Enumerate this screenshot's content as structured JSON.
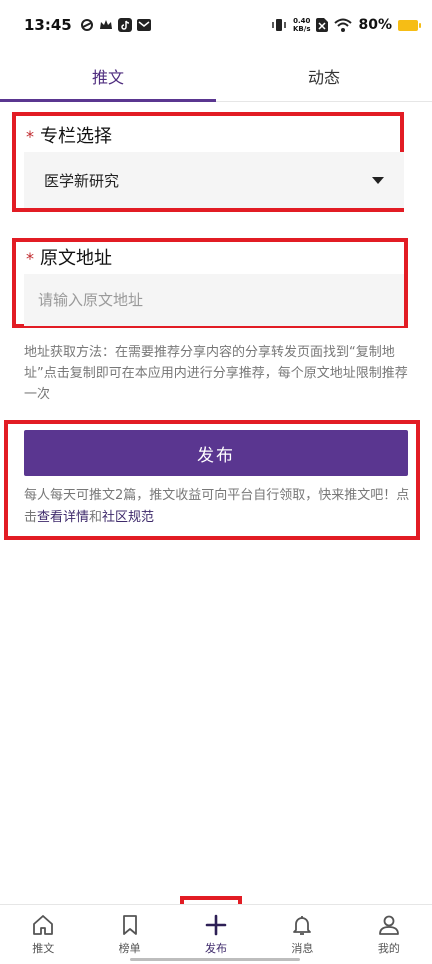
{
  "status_bar": {
    "time": "13:45",
    "net_speed_value": "0.40",
    "net_speed_unit": "KB/s",
    "battery": "80%",
    "icons": [
      "sync-icon",
      "crown-icon",
      "tiktok-icon",
      "mail-icon",
      "vibrate-icon",
      "sim-icon",
      "wifi-icon",
      "battery-icon"
    ]
  },
  "tabs": [
    {
      "label": "推文",
      "active": true
    },
    {
      "label": "动态",
      "active": false
    }
  ],
  "form": {
    "column_label": "专栏选择",
    "column_value": "医学新研究",
    "url_label": "原文地址",
    "url_placeholder": "请输入原文地址",
    "required_mark": "*",
    "hint": "地址获取方法：在需要推荐分享内容的分享转发页面找到“复制地址”点击复制即可在本应用内进行分享推荐，每个原文地址限制推荐一次"
  },
  "publish": {
    "button_label": "发布",
    "note_prefix": "每人每天可推文2篇，推文收益可向平台自行领取，快来推文吧！点击",
    "link_details": "查看详情",
    "note_and": "和",
    "link_rules": "社区规范"
  },
  "bottom_nav": [
    {
      "label": "推文",
      "icon": "home-icon"
    },
    {
      "label": "榜单",
      "icon": "bookmark-icon"
    },
    {
      "label": "发布",
      "icon": "plus-icon",
      "active": true
    },
    {
      "label": "消息",
      "icon": "bell-icon"
    },
    {
      "label": "我的",
      "icon": "user-icon"
    }
  ],
  "colors": {
    "accent": "#5a3690",
    "highlight_box": "#e21c24",
    "required": "#c0282c"
  }
}
